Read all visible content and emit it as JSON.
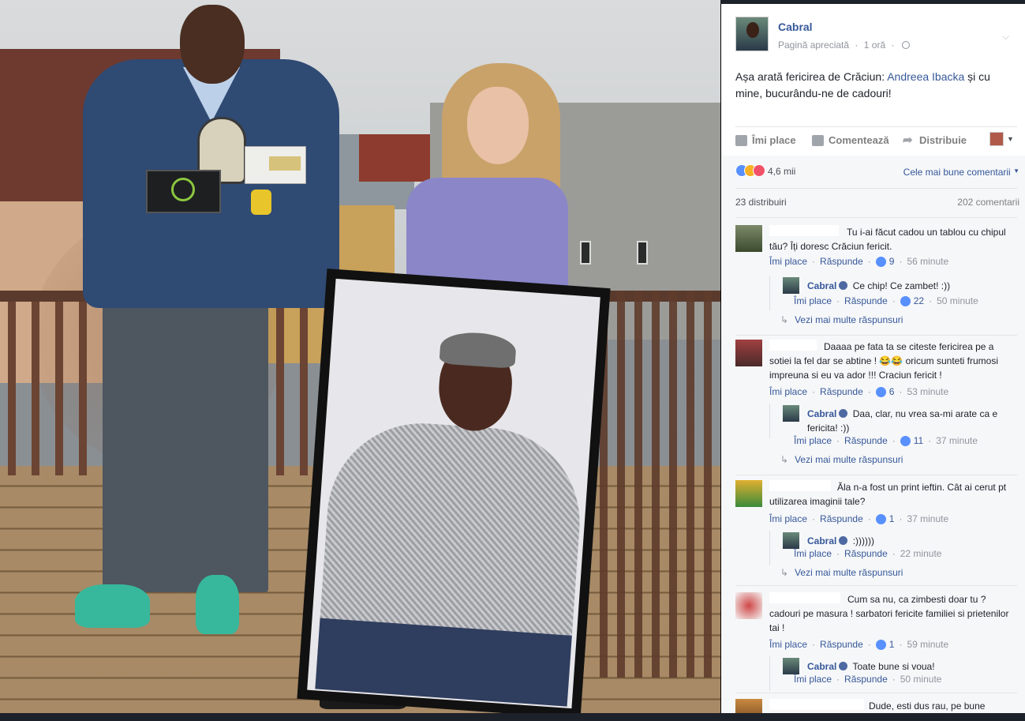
{
  "post": {
    "author": "Cabral",
    "meta_liked": "Pagină apreciată",
    "meta_dot": "·",
    "meta_time": "1 oră",
    "text_before": "Așa arată fericirea de Crăciun: ",
    "text_tag": "Andreea Ibacka",
    "text_after": " și cu mine, bucurându-ne de cadouri!"
  },
  "actions": {
    "like": "Îmi place",
    "comment": "Comentează",
    "share": "Distribuie"
  },
  "reactions": {
    "count": "4,6 mii",
    "sort_label": "Cele mai bune comentarii",
    "shares": "23 distribuiri",
    "comments": "202 comentarii"
  },
  "labels": {
    "like": "Îmi place",
    "reply": "Răspunde",
    "more_replies": "Vezi mai multe răspunsuri"
  },
  "comments": [
    {
      "text": "Tu i-ai făcut cadou un tablou cu chipul tău? Îți doresc Crăciun fericit.",
      "likes": "9",
      "time": "56 minute",
      "reply": {
        "author": "Cabral",
        "text": "Ce chip! Ce zambet! :))",
        "likes": "22",
        "time": "50 minute"
      }
    },
    {
      "text": "Daaaa pe fata ta se citeste fericirea pe a sotiei la fel dar se abtine ! 😂😂 oricum sunteti frumosi impreuna si eu va ador !!! Craciun fericit !",
      "likes": "6",
      "time": "53 minute",
      "reply": {
        "author": "Cabral",
        "text": "Daa, clar, nu vrea sa-mi arate ca e fericita! :))",
        "likes": "11",
        "time": "37 minute"
      }
    },
    {
      "text": "Ăla n-a fost un print ieftin. Cât ai cerut pt utilizarea imaginii tale?",
      "likes": "1",
      "time": "37 minute",
      "reply": {
        "author": "Cabral",
        "text": ":))))))",
        "time": "22 minute"
      }
    },
    {
      "text": "Cum sa nu, ca zimbesti doar tu ? cadouri pe masura ! sarbatori fericite familiei si prietenilor tai !",
      "likes": "1",
      "time": "59 minute",
      "reply": {
        "author": "Cabral",
        "text": "Toate bune si voua!",
        "time": "50 minute"
      }
    },
    {
      "text": "Dude, esti dus rau, pe bune"
    }
  ],
  "colors": {
    "link": "#365899",
    "meta": "#90949c",
    "panel_bg": "#f6f7f9",
    "like_blue": "#5890ff"
  }
}
